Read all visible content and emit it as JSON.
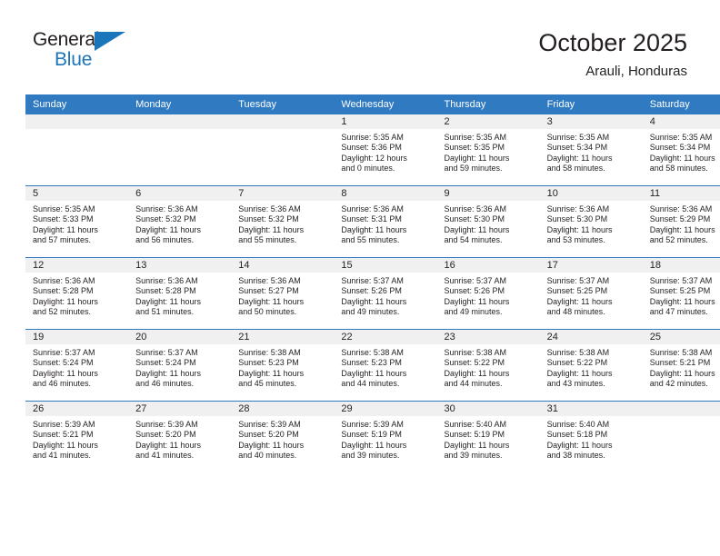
{
  "brand": {
    "name_part1": "General",
    "name_part2": "Blue",
    "accent_color": "#1b75bb"
  },
  "header": {
    "title": "October 2025",
    "location": "Arauli, Honduras"
  },
  "theme": {
    "header_row_bg": "#2f7ac1",
    "day_band_bg": "#f0f0f0",
    "text_color": "#231f20"
  },
  "weekdays": [
    "Sunday",
    "Monday",
    "Tuesday",
    "Wednesday",
    "Thursday",
    "Friday",
    "Saturday"
  ],
  "labels": {
    "sunrise_prefix": "Sunrise:",
    "sunset_prefix": "Sunset:",
    "daylight_prefix": "Daylight:"
  },
  "weeks": [
    [
      {
        "day": "",
        "empty": true
      },
      {
        "day": "",
        "empty": true
      },
      {
        "day": "",
        "empty": true
      },
      {
        "day": "1",
        "sunrise": "Sunrise: 5:35 AM",
        "sunset": "Sunset: 5:36 PM",
        "daylight_l1": "Daylight: 12 hours",
        "daylight_l2": "and 0 minutes."
      },
      {
        "day": "2",
        "sunrise": "Sunrise: 5:35 AM",
        "sunset": "Sunset: 5:35 PM",
        "daylight_l1": "Daylight: 11 hours",
        "daylight_l2": "and 59 minutes."
      },
      {
        "day": "3",
        "sunrise": "Sunrise: 5:35 AM",
        "sunset": "Sunset: 5:34 PM",
        "daylight_l1": "Daylight: 11 hours",
        "daylight_l2": "and 58 minutes."
      },
      {
        "day": "4",
        "sunrise": "Sunrise: 5:35 AM",
        "sunset": "Sunset: 5:34 PM",
        "daylight_l1": "Daylight: 11 hours",
        "daylight_l2": "and 58 minutes."
      }
    ],
    [
      {
        "day": "5",
        "sunrise": "Sunrise: 5:35 AM",
        "sunset": "Sunset: 5:33 PM",
        "daylight_l1": "Daylight: 11 hours",
        "daylight_l2": "and 57 minutes."
      },
      {
        "day": "6",
        "sunrise": "Sunrise: 5:36 AM",
        "sunset": "Sunset: 5:32 PM",
        "daylight_l1": "Daylight: 11 hours",
        "daylight_l2": "and 56 minutes."
      },
      {
        "day": "7",
        "sunrise": "Sunrise: 5:36 AM",
        "sunset": "Sunset: 5:32 PM",
        "daylight_l1": "Daylight: 11 hours",
        "daylight_l2": "and 55 minutes."
      },
      {
        "day": "8",
        "sunrise": "Sunrise: 5:36 AM",
        "sunset": "Sunset: 5:31 PM",
        "daylight_l1": "Daylight: 11 hours",
        "daylight_l2": "and 55 minutes."
      },
      {
        "day": "9",
        "sunrise": "Sunrise: 5:36 AM",
        "sunset": "Sunset: 5:30 PM",
        "daylight_l1": "Daylight: 11 hours",
        "daylight_l2": "and 54 minutes."
      },
      {
        "day": "10",
        "sunrise": "Sunrise: 5:36 AM",
        "sunset": "Sunset: 5:30 PM",
        "daylight_l1": "Daylight: 11 hours",
        "daylight_l2": "and 53 minutes."
      },
      {
        "day": "11",
        "sunrise": "Sunrise: 5:36 AM",
        "sunset": "Sunset: 5:29 PM",
        "daylight_l1": "Daylight: 11 hours",
        "daylight_l2": "and 52 minutes."
      }
    ],
    [
      {
        "day": "12",
        "sunrise": "Sunrise: 5:36 AM",
        "sunset": "Sunset: 5:28 PM",
        "daylight_l1": "Daylight: 11 hours",
        "daylight_l2": "and 52 minutes."
      },
      {
        "day": "13",
        "sunrise": "Sunrise: 5:36 AM",
        "sunset": "Sunset: 5:28 PM",
        "daylight_l1": "Daylight: 11 hours",
        "daylight_l2": "and 51 minutes."
      },
      {
        "day": "14",
        "sunrise": "Sunrise: 5:36 AM",
        "sunset": "Sunset: 5:27 PM",
        "daylight_l1": "Daylight: 11 hours",
        "daylight_l2": "and 50 minutes."
      },
      {
        "day": "15",
        "sunrise": "Sunrise: 5:37 AM",
        "sunset": "Sunset: 5:26 PM",
        "daylight_l1": "Daylight: 11 hours",
        "daylight_l2": "and 49 minutes."
      },
      {
        "day": "16",
        "sunrise": "Sunrise: 5:37 AM",
        "sunset": "Sunset: 5:26 PM",
        "daylight_l1": "Daylight: 11 hours",
        "daylight_l2": "and 49 minutes."
      },
      {
        "day": "17",
        "sunrise": "Sunrise: 5:37 AM",
        "sunset": "Sunset: 5:25 PM",
        "daylight_l1": "Daylight: 11 hours",
        "daylight_l2": "and 48 minutes."
      },
      {
        "day": "18",
        "sunrise": "Sunrise: 5:37 AM",
        "sunset": "Sunset: 5:25 PM",
        "daylight_l1": "Daylight: 11 hours",
        "daylight_l2": "and 47 minutes."
      }
    ],
    [
      {
        "day": "19",
        "sunrise": "Sunrise: 5:37 AM",
        "sunset": "Sunset: 5:24 PM",
        "daylight_l1": "Daylight: 11 hours",
        "daylight_l2": "and 46 minutes."
      },
      {
        "day": "20",
        "sunrise": "Sunrise: 5:37 AM",
        "sunset": "Sunset: 5:24 PM",
        "daylight_l1": "Daylight: 11 hours",
        "daylight_l2": "and 46 minutes."
      },
      {
        "day": "21",
        "sunrise": "Sunrise: 5:38 AM",
        "sunset": "Sunset: 5:23 PM",
        "daylight_l1": "Daylight: 11 hours",
        "daylight_l2": "and 45 minutes."
      },
      {
        "day": "22",
        "sunrise": "Sunrise: 5:38 AM",
        "sunset": "Sunset: 5:23 PM",
        "daylight_l1": "Daylight: 11 hours",
        "daylight_l2": "and 44 minutes."
      },
      {
        "day": "23",
        "sunrise": "Sunrise: 5:38 AM",
        "sunset": "Sunset: 5:22 PM",
        "daylight_l1": "Daylight: 11 hours",
        "daylight_l2": "and 44 minutes."
      },
      {
        "day": "24",
        "sunrise": "Sunrise: 5:38 AM",
        "sunset": "Sunset: 5:22 PM",
        "daylight_l1": "Daylight: 11 hours",
        "daylight_l2": "and 43 minutes."
      },
      {
        "day": "25",
        "sunrise": "Sunrise: 5:38 AM",
        "sunset": "Sunset: 5:21 PM",
        "daylight_l1": "Daylight: 11 hours",
        "daylight_l2": "and 42 minutes."
      }
    ],
    [
      {
        "day": "26",
        "sunrise": "Sunrise: 5:39 AM",
        "sunset": "Sunset: 5:21 PM",
        "daylight_l1": "Daylight: 11 hours",
        "daylight_l2": "and 41 minutes."
      },
      {
        "day": "27",
        "sunrise": "Sunrise: 5:39 AM",
        "sunset": "Sunset: 5:20 PM",
        "daylight_l1": "Daylight: 11 hours",
        "daylight_l2": "and 41 minutes."
      },
      {
        "day": "28",
        "sunrise": "Sunrise: 5:39 AM",
        "sunset": "Sunset: 5:20 PM",
        "daylight_l1": "Daylight: 11 hours",
        "daylight_l2": "and 40 minutes."
      },
      {
        "day": "29",
        "sunrise": "Sunrise: 5:39 AM",
        "sunset": "Sunset: 5:19 PM",
        "daylight_l1": "Daylight: 11 hours",
        "daylight_l2": "and 39 minutes."
      },
      {
        "day": "30",
        "sunrise": "Sunrise: 5:40 AM",
        "sunset": "Sunset: 5:19 PM",
        "daylight_l1": "Daylight: 11 hours",
        "daylight_l2": "and 39 minutes."
      },
      {
        "day": "31",
        "sunrise": "Sunrise: 5:40 AM",
        "sunset": "Sunset: 5:18 PM",
        "daylight_l1": "Daylight: 11 hours",
        "daylight_l2": "and 38 minutes."
      },
      {
        "day": "",
        "empty": true
      }
    ]
  ]
}
